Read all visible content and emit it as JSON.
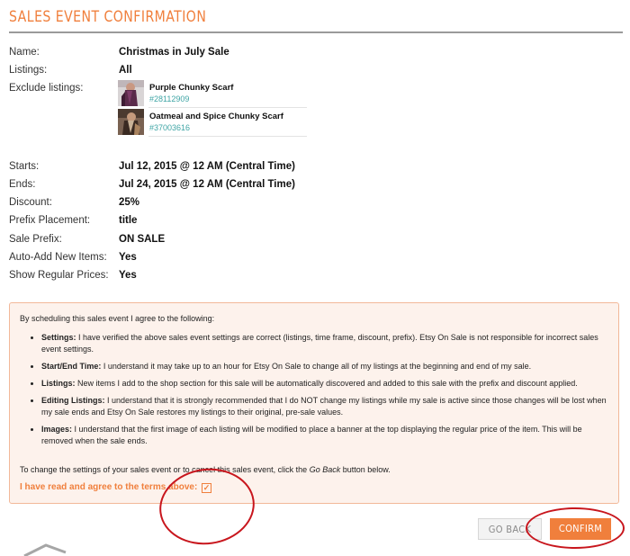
{
  "header": {
    "title": "SALES EVENT CONFIRMATION"
  },
  "details": [
    {
      "label": "Name:",
      "value": "Christmas in July Sale"
    },
    {
      "label": "Listings:",
      "value": "All"
    },
    {
      "label": "Exclude listings:",
      "value": ""
    },
    {
      "label": "Starts:",
      "value": "Jul 12, 2015 @ 12 AM (Central Time)"
    },
    {
      "label": "Ends:",
      "value": "Jul 24, 2015 @ 12 AM (Central Time)"
    },
    {
      "label": "Discount:",
      "value": "25%"
    },
    {
      "label": "Prefix Placement:",
      "value": "title"
    },
    {
      "label": "Sale Prefix:",
      "value": "ON SALE"
    },
    {
      "label": "Auto-Add New Items:",
      "value": "Yes"
    },
    {
      "label": "Show Regular Prices:",
      "value": "Yes"
    }
  ],
  "excluded_listings": [
    {
      "name": "Purple Chunky Scarf",
      "id": "#28112909"
    },
    {
      "name": "Oatmeal and Spice Chunky Scarf",
      "id": "#37003616"
    }
  ],
  "terms": {
    "intro": "By scheduling this sales event I agree to the following:",
    "items": [
      {
        "title": "Settings:",
        "text": " I have verified the above sales event settings are correct (listings, time frame, discount, prefix). Etsy On Sale is not responsible for incorrect sales event settings."
      },
      {
        "title": "Start/End Time:",
        "text": " I understand it may take up to an hour for Etsy On Sale to change all of my listings at the beginning and end of my sale."
      },
      {
        "title": "Listings:",
        "text": " New items I add to the shop section for this sale will be automatically discovered and added to this sale with the prefix and discount applied."
      },
      {
        "title": "Editing Listings:",
        "text": " I understand that it is strongly recommended that I do NOT change my listings while my sale is active since those changes will be lost when my sale ends and Etsy On Sale restores my listings to their original, pre-sale values."
      },
      {
        "title": "Images:",
        "text": " I understand that the first image of each listing will be modified to place a banner at the top displaying the regular price of the item. This will be removed when the sale ends."
      }
    ],
    "change_pre": "To change the settings of your sales event or to cancel this sales event, click the ",
    "change_link": "Go Back",
    "change_post": " button below.",
    "agree_label": "I have read and agree to the terms above:",
    "agree_checked": true
  },
  "buttons": {
    "back": "GO BACK",
    "confirm": "CONFIRM"
  },
  "colors": {
    "accent": "#f07f3c",
    "annotation": "#c8161d",
    "link_teal": "#3fa5a5"
  }
}
